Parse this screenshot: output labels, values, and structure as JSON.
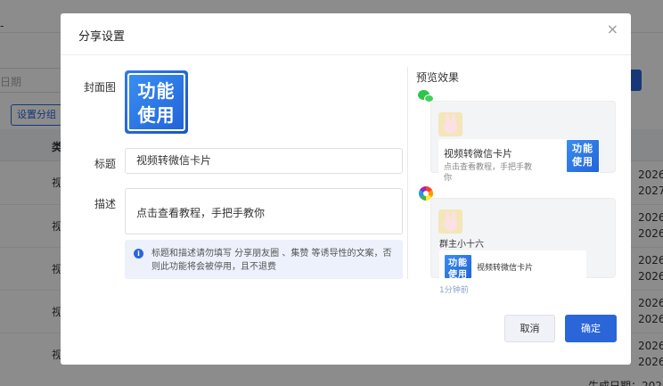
{
  "background": {
    "date_placeholder": "日期",
    "group_button": "设置分组",
    "column_header": "类",
    "row_texts": [
      "视",
      "视",
      "视",
      "视",
      "视"
    ],
    "dates": [
      "2026-",
      "2027-",
      "2026-",
      "2026-",
      "2026-",
      "2026-",
      "2026-",
      "2026-",
      "2026-",
      "2026-"
    ],
    "bottom_text": "生成日期：2026"
  },
  "modal": {
    "title": "分享设置",
    "close_symbol": "×",
    "cover_label": "封面图",
    "cover_logo_line1": "功能",
    "cover_logo_line2": "使用",
    "title_label": "标题",
    "title_value": "视频转微信卡片",
    "desc_label": "描述",
    "desc_value": "点击查看教程，手把手教你",
    "notice_text": "标题和描述请勿填写 分享朋友圈 、集赞 等诱导性的文案，否则此功能将会被停用，且不退费",
    "notice_icon": "i",
    "cancel_label": "取消",
    "ok_label": "确定"
  },
  "preview": {
    "title": "预览效果",
    "wechat_card": {
      "title": "视频转微信卡片",
      "desc": "点击查看教程，手把手教你",
      "thumb_line1": "功能",
      "thumb_line2": "使用"
    },
    "moments_card": {
      "name": "群主小十六",
      "link_title": "视频转微信卡片",
      "thumb_line1": "功能",
      "thumb_line2": "使用",
      "time": "1分钟前"
    }
  },
  "icons": {
    "wechat": "wechat-icon",
    "moments": "moments-icon",
    "info": "info-icon",
    "close": "close-icon"
  },
  "colors": {
    "primary": "#2a66d8",
    "notice_bg": "#ecf1fb",
    "overlay": "rgba(0,0,0,0.45)"
  }
}
